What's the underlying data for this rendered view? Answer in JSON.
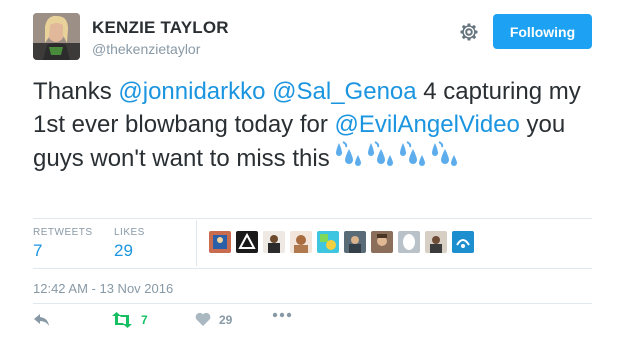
{
  "user": {
    "name": "KENZIE TAYLOR",
    "handle": "@thekenzietaylor"
  },
  "header": {
    "follow_label": "Following",
    "settings_icon": "gear-icon"
  },
  "tweet": {
    "part1": "Thanks ",
    "mention1": "@jonnidarkko",
    "space1": " ",
    "mention2": "@Sal_Genoa",
    "part2": " 4 capturing my 1st ever blowbang today for ",
    "mention3": "@EvilAngelVideo",
    "part3": "  you guys won't want to miss this",
    "emoji": "sweat-droplets-emoji x4"
  },
  "stats": {
    "retweets_label": "RETWEETS",
    "retweets_value": "7",
    "likes_label": "LIKES",
    "likes_value": "29"
  },
  "likers_count_shown": 10,
  "timestamp": "12:42 AM - 13 Nov 2016",
  "actions": {
    "reply_icon": "reply-icon",
    "retweet_count": "7",
    "like_count": "29",
    "more_icon": "more-icon"
  },
  "colors": {
    "accent": "#1da1f2",
    "link": "#1b95e0",
    "retweet_green": "#17bf63",
    "muted": "#8899a6"
  }
}
